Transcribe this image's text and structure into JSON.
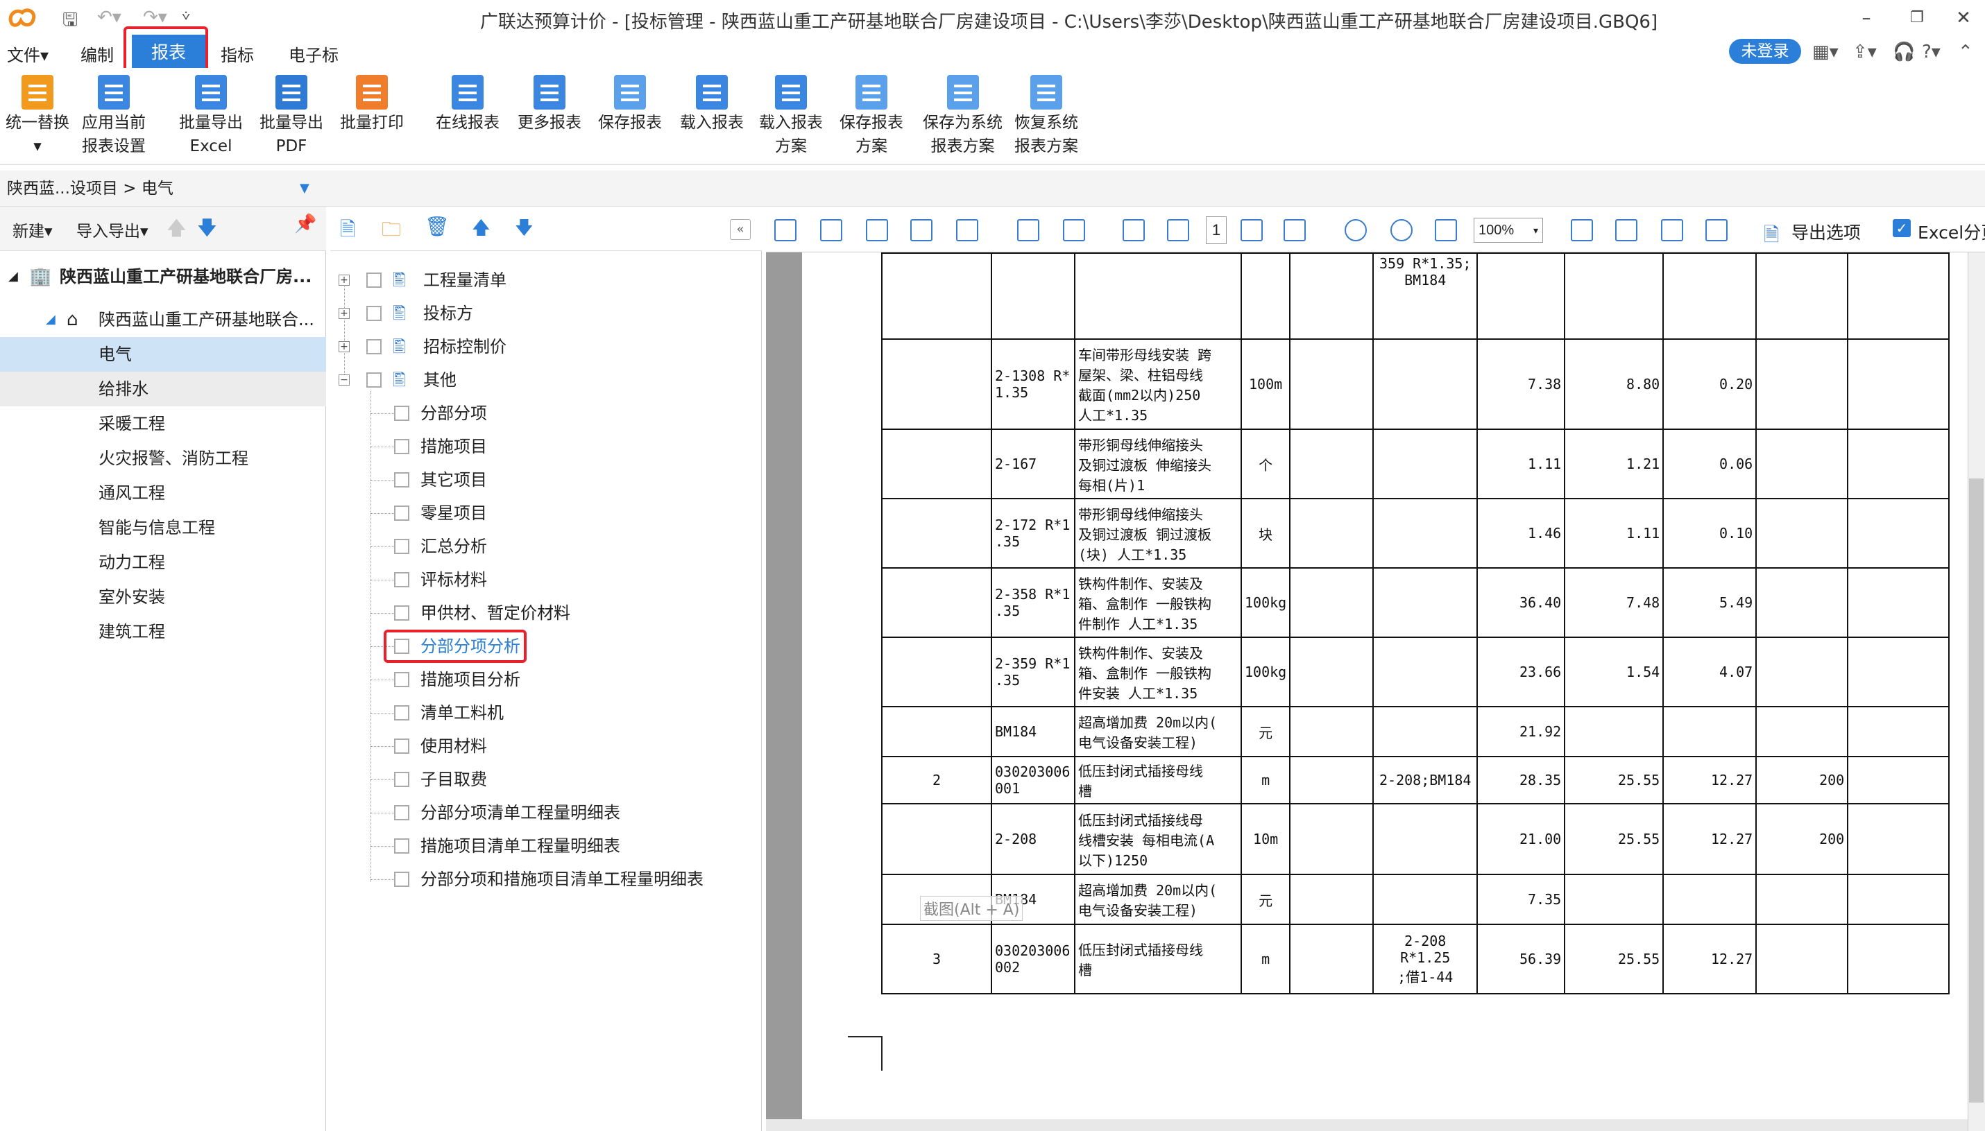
{
  "window": {
    "title": "广联达预算计价 - [投标管理 - 陕西蓝山重工产研基地联合厂房建设项目 - C:\\Users\\李莎\\Desktop\\陕西蓝山重工产研基地联合厂房建设项目.GBQ6]",
    "minimize": "–",
    "restore": "❐",
    "close": "✕"
  },
  "menu": {
    "file": "文件▾",
    "edit": "编制",
    "report": "报表",
    "index": "指标",
    "ebid": "电子标",
    "login": "未登录"
  },
  "ribbon": [
    {
      "l1": "统一替换",
      "l2": "▾",
      "icon": "replace-icon"
    },
    {
      "l1": "应用当前",
      "l2": "报表设置",
      "icon": "apply-settings-icon"
    },
    {
      "l1": "批量导出",
      "l2": "Excel",
      "icon": "export-excel-icon"
    },
    {
      "l1": "批量导出",
      "l2": "PDF",
      "icon": "export-pdf-icon"
    },
    {
      "l1": "批量打印",
      "l2": "",
      "icon": "print-icon"
    },
    {
      "l1": "在线报表",
      "l2": "",
      "icon": "online-report-icon"
    },
    {
      "l1": "更多报表",
      "l2": "",
      "icon": "more-report-icon"
    },
    {
      "l1": "保存报表",
      "l2": "",
      "icon": "save-report-icon"
    },
    {
      "l1": "载入报表",
      "l2": "",
      "icon": "load-report-icon"
    },
    {
      "l1": "载入报表",
      "l2": "方案",
      "icon": "load-scheme-icon"
    },
    {
      "l1": "保存报表",
      "l2": "方案",
      "icon": "save-scheme-icon"
    },
    {
      "l1": "保存为系统",
      "l2": "报表方案",
      "icon": "save-system-icon"
    },
    {
      "l1": "恢复系统",
      "l2": "报表方案",
      "icon": "restore-system-icon"
    }
  ],
  "path": {
    "text": "陕西蓝...设项目 > 电气"
  },
  "left": {
    "new": "新建▾",
    "import_export": "导入导出▾",
    "project": "陕西蓝山重工产研基地联合厂房...",
    "subproject": "陕西蓝山重工产研基地联合...",
    "items": [
      "电气",
      "给排水",
      "采暖工程",
      "火灾报警、消防工程",
      "通风工程",
      "智能与信息工程",
      "动力工程",
      "室外安装",
      "建筑工程"
    ]
  },
  "reports": {
    "groups": [
      "工程量清单",
      "投标方",
      "招标控制价",
      "其他"
    ],
    "children": [
      "分部分项",
      "措施项目",
      "其它项目",
      "零星项目",
      "汇总分析",
      "评标材料",
      "甲供材、暂定价材料",
      "分部分项分析",
      "措施项目分析",
      "清单工料机",
      "使用材料",
      "子目取费",
      "分部分项清单工程量明细表",
      "措施项目清单工程量明细表",
      "分部分项和措施项目清单工程量明细表"
    ]
  },
  "viewer": {
    "page": "1",
    "zoom": "100%",
    "export_options": "导出选项",
    "excel_label": "Excel分页",
    "watermark": "截图(Alt + A)"
  },
  "table": [
    {
      "no": "",
      "code": "",
      "name": "",
      "unit": "",
      "qty": "",
      "ref": "359 R*1.35;\nBM184",
      "c1": "",
      "c2": "",
      "c3": "",
      "c4": "",
      "c5": ""
    },
    {
      "no": "",
      "code": "2-1308 R*\n1.35",
      "name": "车间带形母线安装 跨\n屋架、梁、柱铝母线\n截面(mm2以内)250\n人工*1.35",
      "unit": "100m",
      "qty": "",
      "ref": "",
      "c1": "7.38",
      "c2": "8.80",
      "c3": "0.20",
      "c4": "",
      "c5": ""
    },
    {
      "no": "",
      "code": "2-167",
      "name": "带形铜母线伸缩接头\n及铜过渡板 伸缩接头\n每相(片)1",
      "unit": "个",
      "qty": "",
      "ref": "",
      "c1": "1.11",
      "c2": "1.21",
      "c3": "0.06",
      "c4": "",
      "c5": ""
    },
    {
      "no": "",
      "code": "2-172 R*1\n.35",
      "name": "带形铜母线伸缩接头\n及铜过渡板 铜过渡板\n(块) 人工*1.35",
      "unit": "块",
      "qty": "",
      "ref": "",
      "c1": "1.46",
      "c2": "1.11",
      "c3": "0.10",
      "c4": "",
      "c5": ""
    },
    {
      "no": "",
      "code": "2-358 R*1\n.35",
      "name": "铁构件制作、安装及\n箱、盒制作 一般铁构\n件制作 人工*1.35",
      "unit": "100kg",
      "qty": "",
      "ref": "",
      "c1": "36.40",
      "c2": "7.48",
      "c3": "5.49",
      "c4": "",
      "c5": ""
    },
    {
      "no": "",
      "code": "2-359 R*1\n.35",
      "name": "铁构件制作、安装及\n箱、盒制作 一般铁构\n件安装 人工*1.35",
      "unit": "100kg",
      "qty": "",
      "ref": "",
      "c1": "23.66",
      "c2": "1.54",
      "c3": "4.07",
      "c4": "",
      "c5": ""
    },
    {
      "no": "",
      "code": "BM184",
      "name": "超高增加费 20m以内(\n电气设备安装工程)",
      "unit": "元",
      "qty": "",
      "ref": "",
      "c1": "21.92",
      "c2": "",
      "c3": "",
      "c4": "",
      "c5": ""
    },
    {
      "no": "2",
      "code": "030203006\n001",
      "name": "低压封闭式插接母线\n槽",
      "unit": "m",
      "qty": "",
      "ref": "2-208;BM184",
      "c1": "28.35",
      "c2": "25.55",
      "c3": "12.27",
      "c4": "200",
      "c5": ""
    },
    {
      "no": "",
      "code": "2-208",
      "name": "低压封闭式插接线母\n线槽安装 每相电流(A\n以下)1250",
      "unit": "10m",
      "qty": "",
      "ref": "",
      "c1": "21.00",
      "c2": "25.55",
      "c3": "12.27",
      "c4": "200",
      "c5": ""
    },
    {
      "no": "",
      "code": "BM184",
      "name": "超高增加费 20m以内(\n电气设备安装工程)",
      "unit": "元",
      "qty": "",
      "ref": "",
      "c1": "7.35",
      "c2": "",
      "c3": "",
      "c4": "",
      "c5": ""
    },
    {
      "no": "3",
      "code": "030203006\n002",
      "name": "低压封闭式插接母线\n槽",
      "unit": "m",
      "qty": "",
      "ref": "2-208 R*1.25\n;借1-44",
      "c1": "56.39",
      "c2": "25.55",
      "c3": "12.27",
      "c4": "",
      "c5": ""
    }
  ]
}
